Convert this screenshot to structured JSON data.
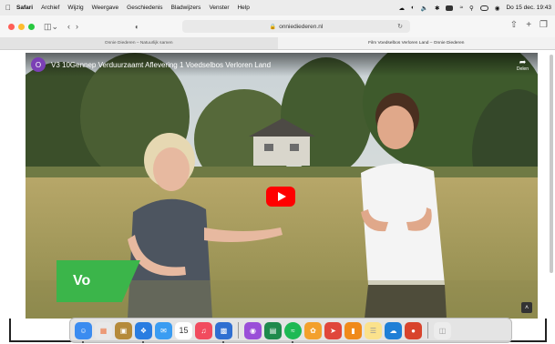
{
  "menubar": {
    "items": [
      "Safari",
      "Archief",
      "Wijzig",
      "Weergave",
      "Geschiedenis",
      "Bladwijzers",
      "Venster",
      "Help"
    ],
    "clock": "Do 15 dec.  19:43"
  },
  "toolbar": {
    "url": "onniediederen.nl"
  },
  "tabs": [
    {
      "label": "Onnie Diederen – Natuurlijk samen"
    },
    {
      "label": "Film Voedselbos Verloren Land – Onnie Diederen"
    }
  ],
  "video": {
    "channel_initial": "O",
    "title": "V3 10Gennep Verduurzaamt Aflevering 1 Voedselbos Verloren Land",
    "share_label": "Delen",
    "badge_text": "Vo"
  },
  "dock": {
    "calendar_day": "15",
    "icons": [
      "finder-icon",
      "launchpad-icon",
      "notes-folder-icon",
      "safari-icon",
      "mail-icon",
      "calendar-icon",
      "music-icon",
      "keynote-icon",
      "podcasts-icon",
      "numbers-icon",
      "spotify-icon",
      "photos-icon",
      "app-icon",
      "books-icon",
      "notes-icon",
      "cloud-icon",
      "office-icon",
      "trash-icon"
    ]
  },
  "colors": {
    "youtube_red": "#ff0000",
    "badge_green": "#3bb54a",
    "channel_purple": "#7b3fb5"
  }
}
